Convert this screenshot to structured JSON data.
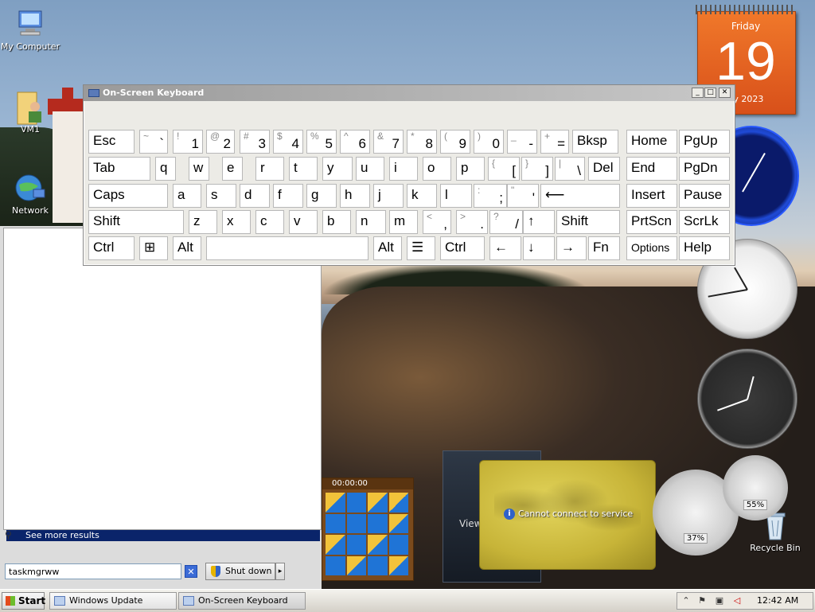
{
  "desktop": {
    "icons": [
      {
        "label": "My Computer",
        "icon": "computer-icon"
      },
      {
        "label": "VM1",
        "icon": "user-folder-icon"
      },
      {
        "label": "Network",
        "icon": "network-icon"
      },
      {
        "label": "Recycle Bin",
        "icon": "recycle-bin-icon"
      }
    ]
  },
  "calendar": {
    "day_name": "Friday",
    "day_number": "19",
    "month_year": "ay 2023"
  },
  "start_menu": {
    "see_more": "See more results",
    "search_value": "taskmgrww",
    "clear_symbol": "✕",
    "shutdown_label": "Shut down",
    "shutdown_arrow": "▸"
  },
  "osk": {
    "title": "On-Screen Keyboard",
    "controls": {
      "minimize": "_",
      "maximize": "□",
      "close": "✕"
    },
    "rows": [
      [
        {
          "label": "Esc"
        },
        {
          "up": "~",
          "dn": "`"
        },
        {
          "up": "!",
          "dn": "1"
        },
        {
          "up": "@",
          "dn": "2"
        },
        {
          "up": "#",
          "dn": "3"
        },
        {
          "up": "$",
          "dn": "4"
        },
        {
          "up": "%",
          "dn": "5"
        },
        {
          "up": "^",
          "dn": "6"
        },
        {
          "up": "&",
          "dn": "7"
        },
        {
          "up": "*",
          "dn": "8"
        },
        {
          "up": "(",
          "dn": "9"
        },
        {
          "up": ")",
          "dn": "0"
        },
        {
          "up": "_",
          "dn": "-"
        },
        {
          "up": "+",
          "dn": "="
        },
        {
          "label": "Bksp"
        },
        {
          "label": "Home"
        },
        {
          "label": "PgUp"
        }
      ],
      [
        {
          "label": "Tab"
        },
        {
          "label": "q"
        },
        {
          "label": "w"
        },
        {
          "label": "e"
        },
        {
          "label": "r"
        },
        {
          "label": "t"
        },
        {
          "label": "y"
        },
        {
          "label": "u"
        },
        {
          "label": "i"
        },
        {
          "label": "o"
        },
        {
          "label": "p"
        },
        {
          "up": "{",
          "dn": "["
        },
        {
          "up": "}",
          "dn": "]"
        },
        {
          "up": "|",
          "dn": "\\"
        },
        {
          "label": "Del"
        },
        {
          "label": "End"
        },
        {
          "label": "PgDn"
        }
      ],
      [
        {
          "label": "Caps"
        },
        {
          "label": "a"
        },
        {
          "label": "s"
        },
        {
          "label": "d"
        },
        {
          "label": "f"
        },
        {
          "label": "g"
        },
        {
          "label": "h"
        },
        {
          "label": "j"
        },
        {
          "label": "k"
        },
        {
          "label": "l"
        },
        {
          "up": ":",
          "dn": ";"
        },
        {
          "up": "\"",
          "dn": "'"
        },
        {
          "label": "⟵"
        },
        {
          "label": "Insert"
        },
        {
          "label": "Pause"
        }
      ],
      [
        {
          "label": "Shift"
        },
        {
          "label": "z"
        },
        {
          "label": "x"
        },
        {
          "label": "c"
        },
        {
          "label": "v"
        },
        {
          "label": "b"
        },
        {
          "label": "n"
        },
        {
          "label": "m"
        },
        {
          "up": "<",
          "dn": ","
        },
        {
          "up": ">",
          "dn": "."
        },
        {
          "up": "?",
          "dn": "/"
        },
        {
          "label": "↑"
        },
        {
          "label": "Shift"
        },
        {
          "label": "PrtScn"
        },
        {
          "label": "ScrLk"
        }
      ],
      [
        {
          "label": "Ctrl"
        },
        {
          "label": "⊞"
        },
        {
          "label": "Alt"
        },
        {
          "label": ""
        },
        {
          "label": "Alt"
        },
        {
          "label": "☰"
        },
        {
          "label": "Ctrl"
        },
        {
          "label": "←"
        },
        {
          "label": "↓"
        },
        {
          "label": "→"
        },
        {
          "label": "Fn"
        },
        {
          "label": "Options"
        },
        {
          "label": "Help"
        }
      ]
    ]
  },
  "gadgets": {
    "dark_tile_text": "View",
    "map_message": "Cannot connect to service",
    "puzzle_timer": "00:00:00",
    "cpu_percent": "37%",
    "memory_percent": "55%"
  },
  "taskbar": {
    "start_label": "Start",
    "tasks": [
      {
        "label": "Windows Update",
        "icon": "windows-update-icon"
      },
      {
        "label": "On-Screen Keyboard",
        "icon": "keyboard-icon"
      }
    ],
    "time": "12:42 AM",
    "tray_icons": [
      "chevron-up-icon",
      "flag-icon",
      "network-icon",
      "volume-muted-icon"
    ]
  }
}
